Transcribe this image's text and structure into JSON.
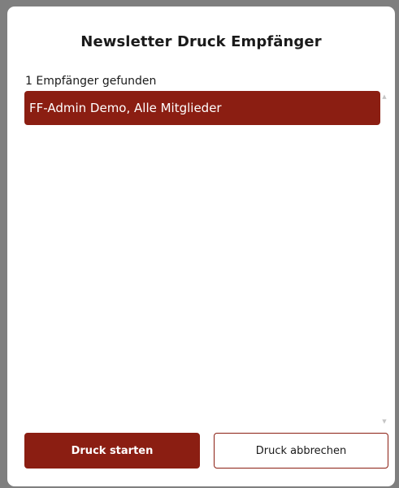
{
  "dialog": {
    "title": "Newsletter Druck Empfänger",
    "count_text": "1 Empfänger gefunden",
    "recipients": [
      {
        "label": "FF-Admin Demo, Alle Mitglieder",
        "selected": true
      }
    ],
    "scroll_up_glyph": "▲",
    "scroll_down_glyph": "▼"
  },
  "buttons": {
    "start_label": "Druck starten",
    "cancel_label": "Druck abbrechen"
  },
  "colors": {
    "accent": "#8b1e12",
    "frame": "#7f7f7f",
    "background": "#ffffff"
  }
}
